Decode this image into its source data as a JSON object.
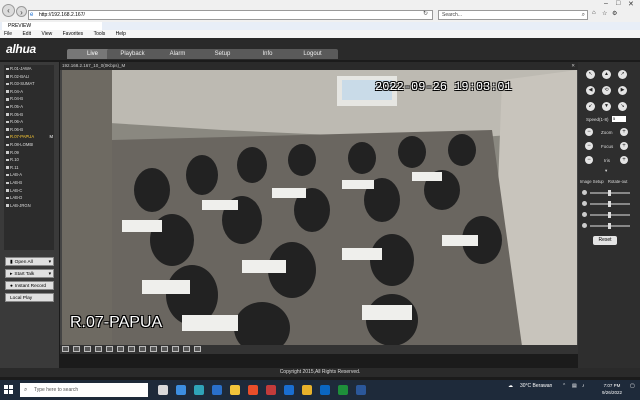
{
  "browser": {
    "url": "http://192.168.2.167/",
    "search_placeholder": "Search...",
    "tab_title": "PREVIEW",
    "menu": [
      "File",
      "Edit",
      "View",
      "Favorites",
      "Tools",
      "Help"
    ]
  },
  "app": {
    "logo": "alhua",
    "nav": [
      "Live",
      "Playback",
      "Alarm",
      "Setup",
      "Info",
      "Logout"
    ],
    "active_nav": "Live"
  },
  "channels": [
    {
      "label": "R.01-JAWA",
      "active": false
    },
    {
      "label": "R.02-BALI",
      "active": false
    },
    {
      "label": "R.03-SUMAT",
      "active": false
    },
    {
      "label": "R.04-A",
      "active": false
    },
    {
      "label": "R.04-B",
      "active": false
    },
    {
      "label": "R.05-A",
      "active": false
    },
    {
      "label": "R.05-B",
      "active": false
    },
    {
      "label": "R.06-A",
      "active": false
    },
    {
      "label": "R.06-B",
      "active": false
    },
    {
      "label": "R.07-PAPUA",
      "active": true,
      "mark": "M"
    },
    {
      "label": "R.08-LOMBI",
      "active": false
    },
    {
      "label": "R.09",
      "active": false
    },
    {
      "label": "R.10",
      "active": false
    },
    {
      "label": "R.11",
      "active": false
    },
    {
      "label": "LAB-A",
      "active": false
    },
    {
      "label": "LAB-B",
      "active": false
    },
    {
      "label": "LAB-C",
      "active": false
    },
    {
      "label": "LAB-D",
      "active": false
    },
    {
      "label": "LAB-JRGN",
      "active": false
    }
  ],
  "controls": {
    "open_all": "Open All",
    "start_talk": "Start Talk",
    "instant_record": "Instant Record",
    "local_play": "Local Play"
  },
  "video": {
    "title_bar": "192.168.2.167_10_0(0Kbps)_M",
    "timestamp": "2022-09-26 19:03:01",
    "camera_name": "R.07-PAPUA"
  },
  "ptz": {
    "speed_label": "Speed(1-8)",
    "speed_value": "5",
    "zoom_label": "Zoom",
    "focus_label": "Focus",
    "iris_label": "Iris",
    "image_setup_label": "Image Setup",
    "rotate_label": "Rotate-out",
    "reset_label": "Reset"
  },
  "footer": {
    "copyright": "Copyright 2015,All Rights Reserved."
  },
  "taskbar": {
    "search_placeholder": "Type here to search",
    "weather": "30°C  Berawan",
    "time": "7:07 PM",
    "date": "9/26/2022"
  }
}
